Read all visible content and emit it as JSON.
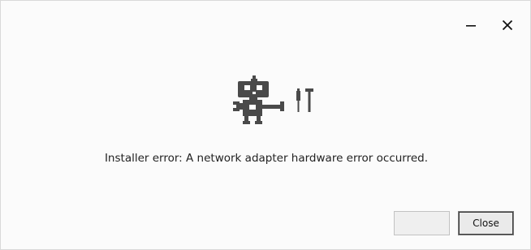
{
  "window": {
    "minimize_icon": "minimize-icon",
    "close_icon": "close-icon"
  },
  "illustration": {
    "icon": "robot-with-tools-icon"
  },
  "message": {
    "text": "Installer error: A network adapter hardware error occurred."
  },
  "buttons": {
    "blank_label": "",
    "close_label": "Close"
  },
  "colors": {
    "background": "#fbfbfb",
    "icon": "#4a4a4a",
    "text": "#222222"
  }
}
